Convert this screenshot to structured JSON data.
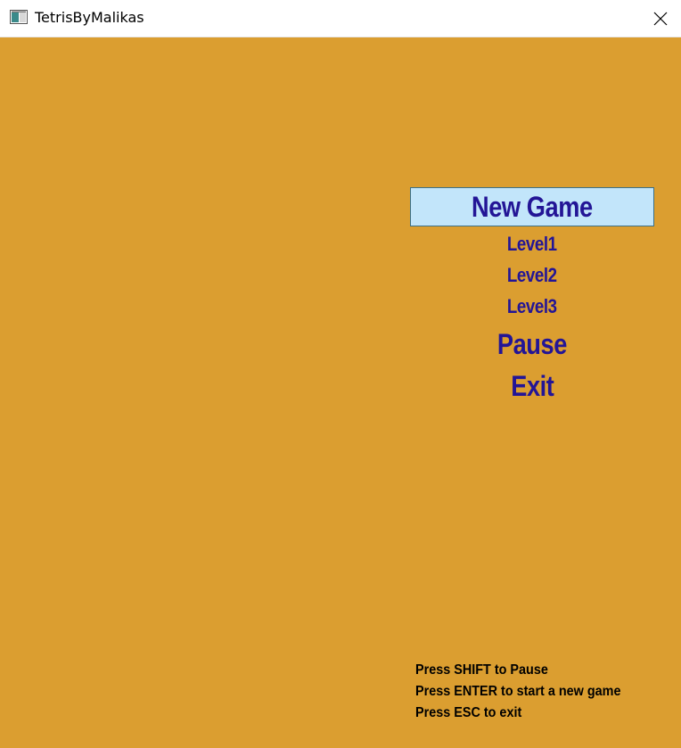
{
  "window": {
    "title": "TetrisByMalikas",
    "close_label": "Close"
  },
  "menu": {
    "items": [
      {
        "label": "New Game",
        "selected": true
      },
      {
        "label": "Level1",
        "selected": false
      },
      {
        "label": "Level2",
        "selected": false
      },
      {
        "label": "Level3",
        "selected": false
      },
      {
        "label": "Pause",
        "selected": false
      },
      {
        "label": "Exit",
        "selected": false
      }
    ]
  },
  "hints": [
    "Press SHIFT to Pause",
    "Press ENTER to start a new game",
    "Press ESC to exit"
  ],
  "colors": {
    "background": "#db9e30",
    "menu_text": "#231596",
    "selected_bg": "#c2e5fa"
  }
}
